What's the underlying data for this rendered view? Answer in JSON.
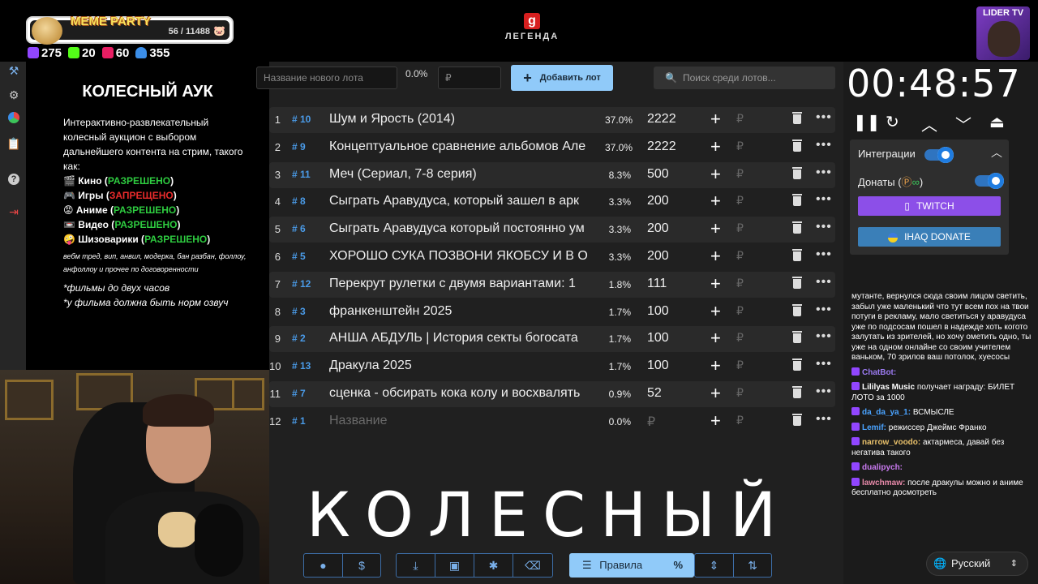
{
  "meme_panel": {
    "title": "MEME PARTY",
    "count": "56 / 11488"
  },
  "stats": [
    {
      "value": "275",
      "icon": "twitch-icon",
      "color": "#9146ff"
    },
    {
      "value": "20",
      "icon": "kick-icon",
      "color": "#53fc18"
    },
    {
      "value": "60",
      "icon": "live-icon",
      "color": "#e91e63"
    },
    {
      "value": "355",
      "icon": "user-icon",
      "color": "#3b8ee8"
    }
  ],
  "logo": {
    "badge": "g",
    "text": "ЛЕГЕНДА"
  },
  "channel_badge": "LIDER TV",
  "info": {
    "title": "КОЛЕСНЫЙ АУК",
    "description": "Интерактивно-развлекательный колесный аукцион с выбором дальнейшего контента на стрим, такого как:",
    "rules": [
      {
        "emoji": "🎬",
        "label": "Кино",
        "status": "РАЗРЕШЕНО",
        "allowed": true
      },
      {
        "emoji": "🎮",
        "label": "Игры",
        "status": "ЗАПРЕЩЕНО",
        "allowed": false
      },
      {
        "emoji": "😡",
        "label": "Аниме",
        "status": "РАЗРЕШЕНО",
        "allowed": true
      },
      {
        "emoji": "📼",
        "label": "Видео",
        "status": "РАЗРЕШЕНО",
        "allowed": true
      },
      {
        "emoji": "🤪",
        "label": "Шизоварики",
        "status": "РАЗРЕШЕНО",
        "allowed": true
      }
    ],
    "small_print": "вебм тред, вип, анвил, модерка, бан разбан, фоллоу, анфоллоу и прочее по договоренности",
    "note1": "*фильмы до двух часов",
    "note2": "*у фильма должна быть норм озвуч"
  },
  "form": {
    "name_placeholder": "Название нового лота",
    "percent": "0.0%",
    "amount_placeholder": "₽",
    "add_label": "Добавить лот",
    "search_placeholder": "Поиск среди лотов..."
  },
  "lots": [
    {
      "n": "1",
      "id": "# 10",
      "name": "Шум и Ярость (2014)",
      "pct": "37.0%",
      "amount": "2222"
    },
    {
      "n": "2",
      "id": "# 9",
      "name": "Концептуальное сравнение альбомов Але",
      "pct": "37.0%",
      "amount": "2222"
    },
    {
      "n": "3",
      "id": "# 11",
      "name": "Меч (Сериал, 7-8 серия)",
      "pct": "8.3%",
      "amount": "500"
    },
    {
      "n": "4",
      "id": "# 8",
      "name": "Сыграть Аравудуса, который зашел в арк",
      "pct": "3.3%",
      "amount": "200"
    },
    {
      "n": "5",
      "id": "# 6",
      "name": "Сыграть Аравудуса который постоянно ум",
      "pct": "3.3%",
      "amount": "200"
    },
    {
      "n": "6",
      "id": "# 5",
      "name": "ХОРОШО СУКА ПОЗВОНИ ЯКОБСУ И В ОБ",
      "pct": "3.3%",
      "amount": "200"
    },
    {
      "n": "7",
      "id": "# 12",
      "name": "Перекрут рулетки с двумя вариантами: 1",
      "pct": "1.8%",
      "amount": "111"
    },
    {
      "n": "8",
      "id": "# 3",
      "name": "франкенштейн 2025",
      "pct": "1.7%",
      "amount": "100"
    },
    {
      "n": "9",
      "id": "# 2",
      "name": "АНША АБДУЛЬ | История секты богосата",
      "pct": "1.7%",
      "amount": "100"
    },
    {
      "n": "10",
      "id": "# 13",
      "name": "Дракула 2025",
      "pct": "1.7%",
      "amount": "100"
    },
    {
      "n": "11",
      "id": "# 7",
      "name": "сценка - обсирать кока колу и восхвалять",
      "pct": "0.9%",
      "amount": "52"
    },
    {
      "n": "12",
      "id": "# 1",
      "name": "Название",
      "pct": "0.0%",
      "amount": "₽",
      "placeholder": true
    }
  ],
  "big_word": "КОЛЕСНЫЙ",
  "bottom": {
    "rules_label": "Правила",
    "percent_symbol": "%"
  },
  "timer": "00:48:57",
  "integrations": {
    "title": "Интеграции",
    "donations_label": "Донаты (",
    "donations_close": ")",
    "twitch_label": "TWITCH",
    "donate_label": "IHAQ DONATE"
  },
  "chat": [
    {
      "user": "",
      "text": "мутанте, вернулся сюда своим лицом светить, забыл уже маленький что тут всем пох на твои потуги в рекламу, мало светиться у аравудуса уже по подсосам пошел в надежде хоть когото залутать из зрителей, но хочу ометить одно, ты уже на одном онлайне со своим учителем ваньком, 70 зрилов ваш потолок, хуесосы",
      "color": "#ffffff"
    },
    {
      "user": "ChatBot:",
      "text": "",
      "color": "#9b7af0"
    },
    {
      "user": "Lililyas Music",
      "text": "получает награду: БИЛЕТ ЛОТО за 1000",
      "color": "#ffffff"
    },
    {
      "user": "da_da_ya_1:",
      "text": "ВСМЫСЛЕ",
      "color": "#4aa3ff"
    },
    {
      "user": "Lemif:",
      "text": "режиссер Джеймс Франко",
      "color": "#4aa3ff"
    },
    {
      "user": "narrow_voodo:",
      "text": "актармеса, давай без негатива такого",
      "color": "#e8c06a"
    },
    {
      "user": "dualipych:",
      "text": "",
      "color": "#c97af0"
    },
    {
      "user": "lawchmaw:",
      "text": "после дракулы можно и аниме бесплатно досмотреть",
      "color": "#e88aaa"
    }
  ],
  "language": "Русский"
}
